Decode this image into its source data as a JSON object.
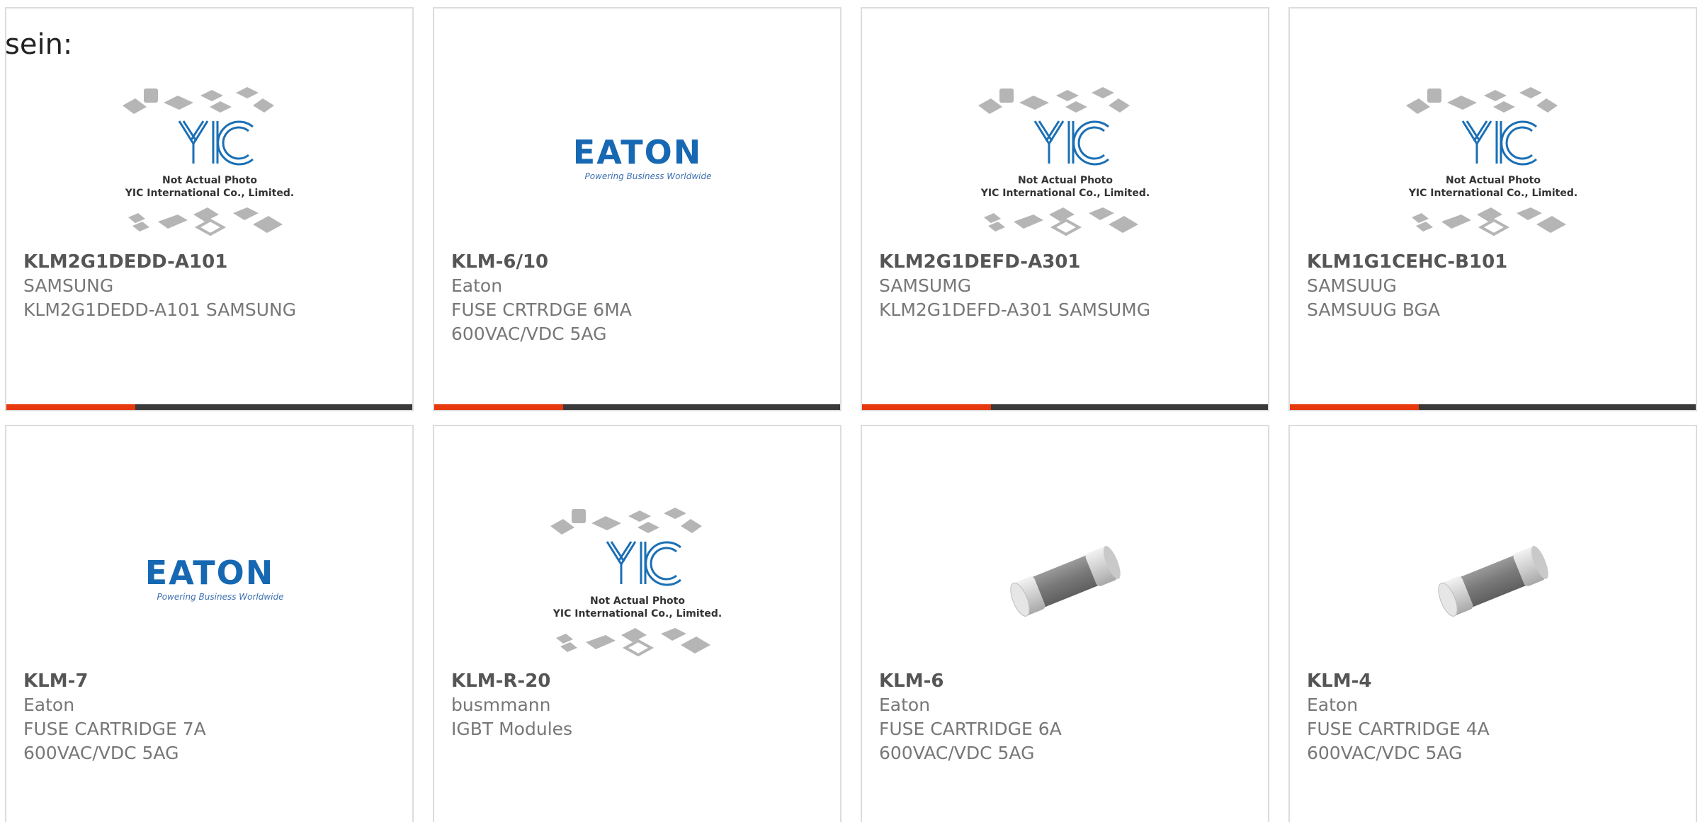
{
  "intro_text": "sein:",
  "accent_color": "#e8380d",
  "bar_color": "#3a3a3a",
  "placeholder": {
    "line1": "Not Actual Photo",
    "line2": "YIC International Co., Limited."
  },
  "eaton": {
    "brand": "EATON",
    "tagline": "Powering Business Worldwide"
  },
  "products": [
    {
      "part": "KLM2G1DEDD-A101",
      "manufacturer": "SAMSUNG",
      "description": "KLM2G1DEDD-A101 SAMSUNG",
      "image": "yic-placeholder"
    },
    {
      "part": "KLM-6/10",
      "manufacturer": "Eaton",
      "description": "FUSE CRTRDGE 6MA\n600VAC/VDC 5AG",
      "image": "eaton-logo"
    },
    {
      "part": "KLM2G1DEFD-A301",
      "manufacturer": "SAMSUMG",
      "description": "KLM2G1DEFD-A301 SAMSUMG",
      "image": "yic-placeholder"
    },
    {
      "part": "KLM1G1CEHC-B101",
      "manufacturer": "SAMSUUG",
      "description": "SAMSUUG BGA",
      "image": "yic-placeholder"
    },
    {
      "part": "KLM-7",
      "manufacturer": "Eaton",
      "description": "FUSE CARTRIDGE 7A\n600VAC/VDC 5AG",
      "image": "eaton-logo"
    },
    {
      "part": "KLM-R-20",
      "manufacturer": "busmmann",
      "description": "IGBT Modules",
      "image": "yic-placeholder"
    },
    {
      "part": "KLM-6",
      "manufacturer": "Eaton",
      "description": "FUSE CARTRIDGE 6A\n600VAC/VDC 5AG",
      "image": "fuse-photo"
    },
    {
      "part": "KLM-4",
      "manufacturer": "Eaton",
      "description": "FUSE CARTRIDGE 4A\n600VAC/VDC 5AG",
      "image": "fuse-photo"
    }
  ]
}
